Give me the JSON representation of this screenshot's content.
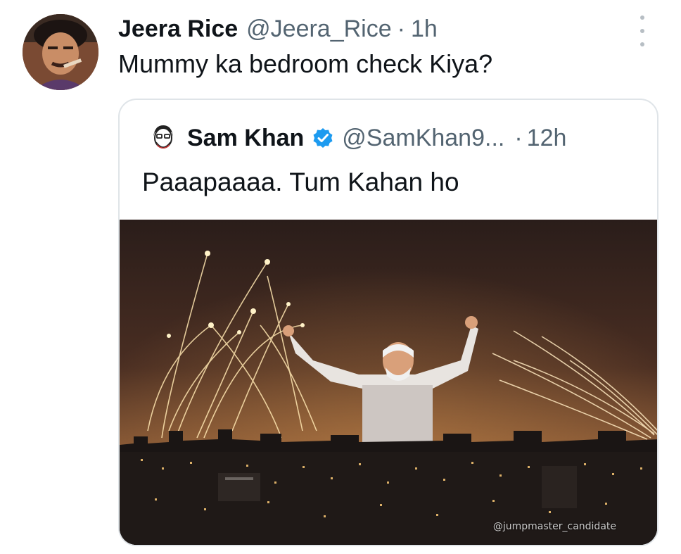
{
  "tweet": {
    "author_name": "Jeera Rice",
    "author_handle": "@Jeera_Rice",
    "separator": "·",
    "time": "1h",
    "text": "Mummy ka bedroom check Kiya?"
  },
  "quoted_tweet": {
    "author_name": "Sam Khan",
    "author_handle": "@SamKhan9...",
    "separator": "·",
    "time": "12h",
    "text": "Paaapaaaa. Tum Kahan ho",
    "media_watermark": "@jumpmaster_candidate"
  },
  "icons": {
    "more": "more-vertical-icon",
    "verified": "verified-badge-icon"
  },
  "colors": {
    "text_primary": "#0f1419",
    "text_secondary": "#536471",
    "verified_blue": "#1d9bf0",
    "border": "#dfe4e8"
  }
}
